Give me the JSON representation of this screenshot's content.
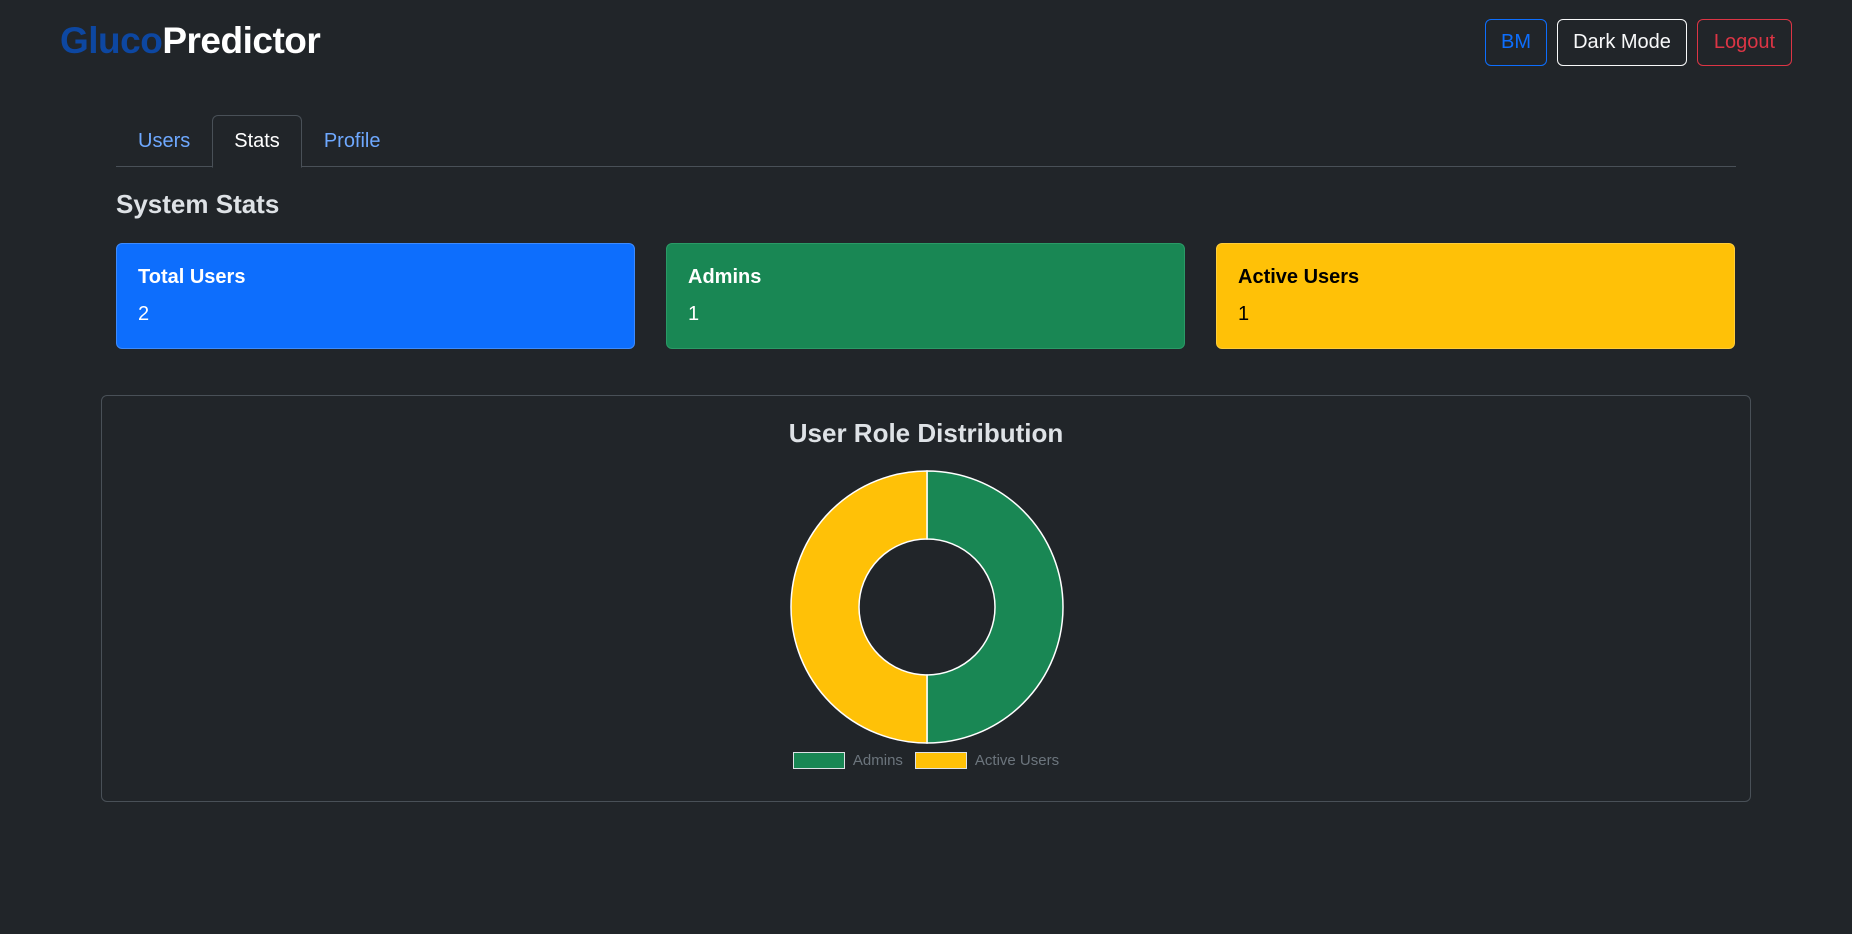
{
  "brand": {
    "part1": "Gluco",
    "part2": "Predictor"
  },
  "nav": {
    "user_initials": "BM",
    "dark_mode": "Dark Mode",
    "logout": "Logout"
  },
  "tabs": [
    {
      "label": "Users",
      "active": false
    },
    {
      "label": "Stats",
      "active": true
    },
    {
      "label": "Profile",
      "active": false
    }
  ],
  "section_title": "System Stats",
  "stats": [
    {
      "title": "Total Users",
      "value": "2",
      "color": "#0d6efd"
    },
    {
      "title": "Admins",
      "value": "1",
      "color": "#198754"
    },
    {
      "title": "Active Users",
      "value": "1",
      "color": "#ffc107"
    }
  ],
  "chart_data": {
    "type": "pie",
    "variant": "doughnut",
    "title": "User Role Distribution",
    "categories": [
      "Admins",
      "Active Users"
    ],
    "values": [
      1,
      1
    ],
    "colors": [
      "#198754",
      "#ffc107"
    ],
    "legend_position": "bottom"
  }
}
